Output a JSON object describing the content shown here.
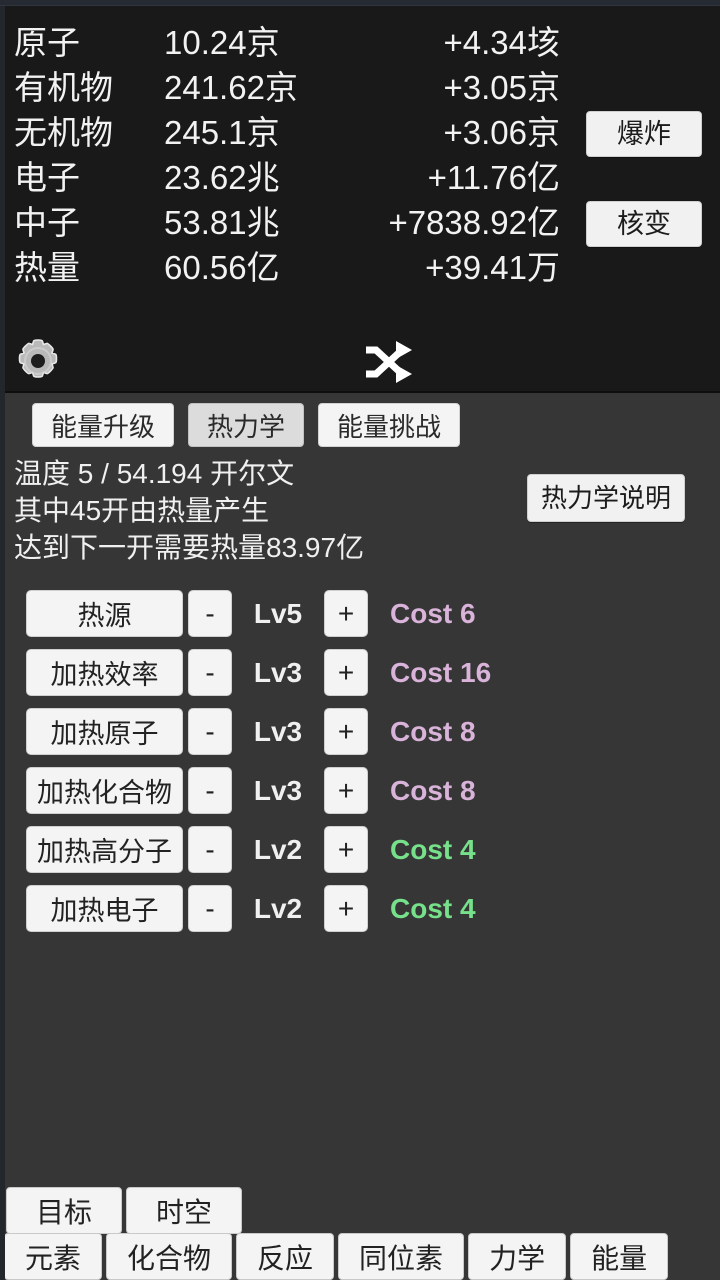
{
  "header": {
    "stats": [
      {
        "name": "原子",
        "value": "10.24京",
        "rate": "+4.34垓"
      },
      {
        "name": "有机物",
        "value": "241.62京",
        "rate": "+3.05京"
      },
      {
        "name": "无机物",
        "value": "245.1京",
        "rate": "+3.06京"
      },
      {
        "name": "电子",
        "value": "23.62兆",
        "rate": "+11.76亿"
      },
      {
        "name": "中子",
        "value": "53.81兆",
        "rate": "+7838.92亿"
      },
      {
        "name": "热量",
        "value": "60.56亿",
        "rate": "+39.41万"
      }
    ],
    "explode_label": "爆炸",
    "fusion_label": "核变",
    "gear_icon": "gear-icon",
    "shuffle_icon": "shuffle-icon"
  },
  "tabs": [
    {
      "label": "能量升级",
      "selected": false
    },
    {
      "label": "热力学",
      "selected": true
    },
    {
      "label": "能量挑战",
      "selected": false
    }
  ],
  "thermo": {
    "line1": "温度 5 / 54.194 开尔文",
    "line2": "其中45开由热量产生",
    "line3": "达到下一开需要热量83.97亿",
    "help_label": "热力学说明"
  },
  "upgrades": {
    "minus_label": "-",
    "plus_label": "+",
    "rows": [
      {
        "name": "热源",
        "level": "Lv5",
        "cost": "Cost 6",
        "cost_color": "#d9b3d9"
      },
      {
        "name": "加热效率",
        "level": "Lv3",
        "cost": "Cost 16",
        "cost_color": "#d9b3d9"
      },
      {
        "name": "加热原子",
        "level": "Lv3",
        "cost": "Cost 8",
        "cost_color": "#d9b3d9"
      },
      {
        "name": "加热化合物",
        "level": "Lv3",
        "cost": "Cost 8",
        "cost_color": "#d9b3d9"
      },
      {
        "name": "加热高分子",
        "level": "Lv2",
        "cost": "Cost 4",
        "cost_color": "#76e08a"
      },
      {
        "name": "加热电子",
        "level": "Lv2",
        "cost": "Cost 4",
        "cost_color": "#76e08a"
      }
    ]
  },
  "bottom_nav": {
    "top_row": [
      {
        "label": "目标"
      },
      {
        "label": "时空"
      }
    ],
    "bottom_row": [
      {
        "label": "元素"
      },
      {
        "label": "化合物"
      },
      {
        "label": "反应"
      },
      {
        "label": "同位素"
      },
      {
        "label": "力学"
      },
      {
        "label": "能量"
      }
    ]
  },
  "colors": {
    "header_bg": "#191919",
    "panel_bg": "#363636",
    "button_bg": "#f4f4f4",
    "text": "#f0f0f0",
    "cost_pink": "#d9b3d9",
    "cost_green": "#76e08a"
  }
}
